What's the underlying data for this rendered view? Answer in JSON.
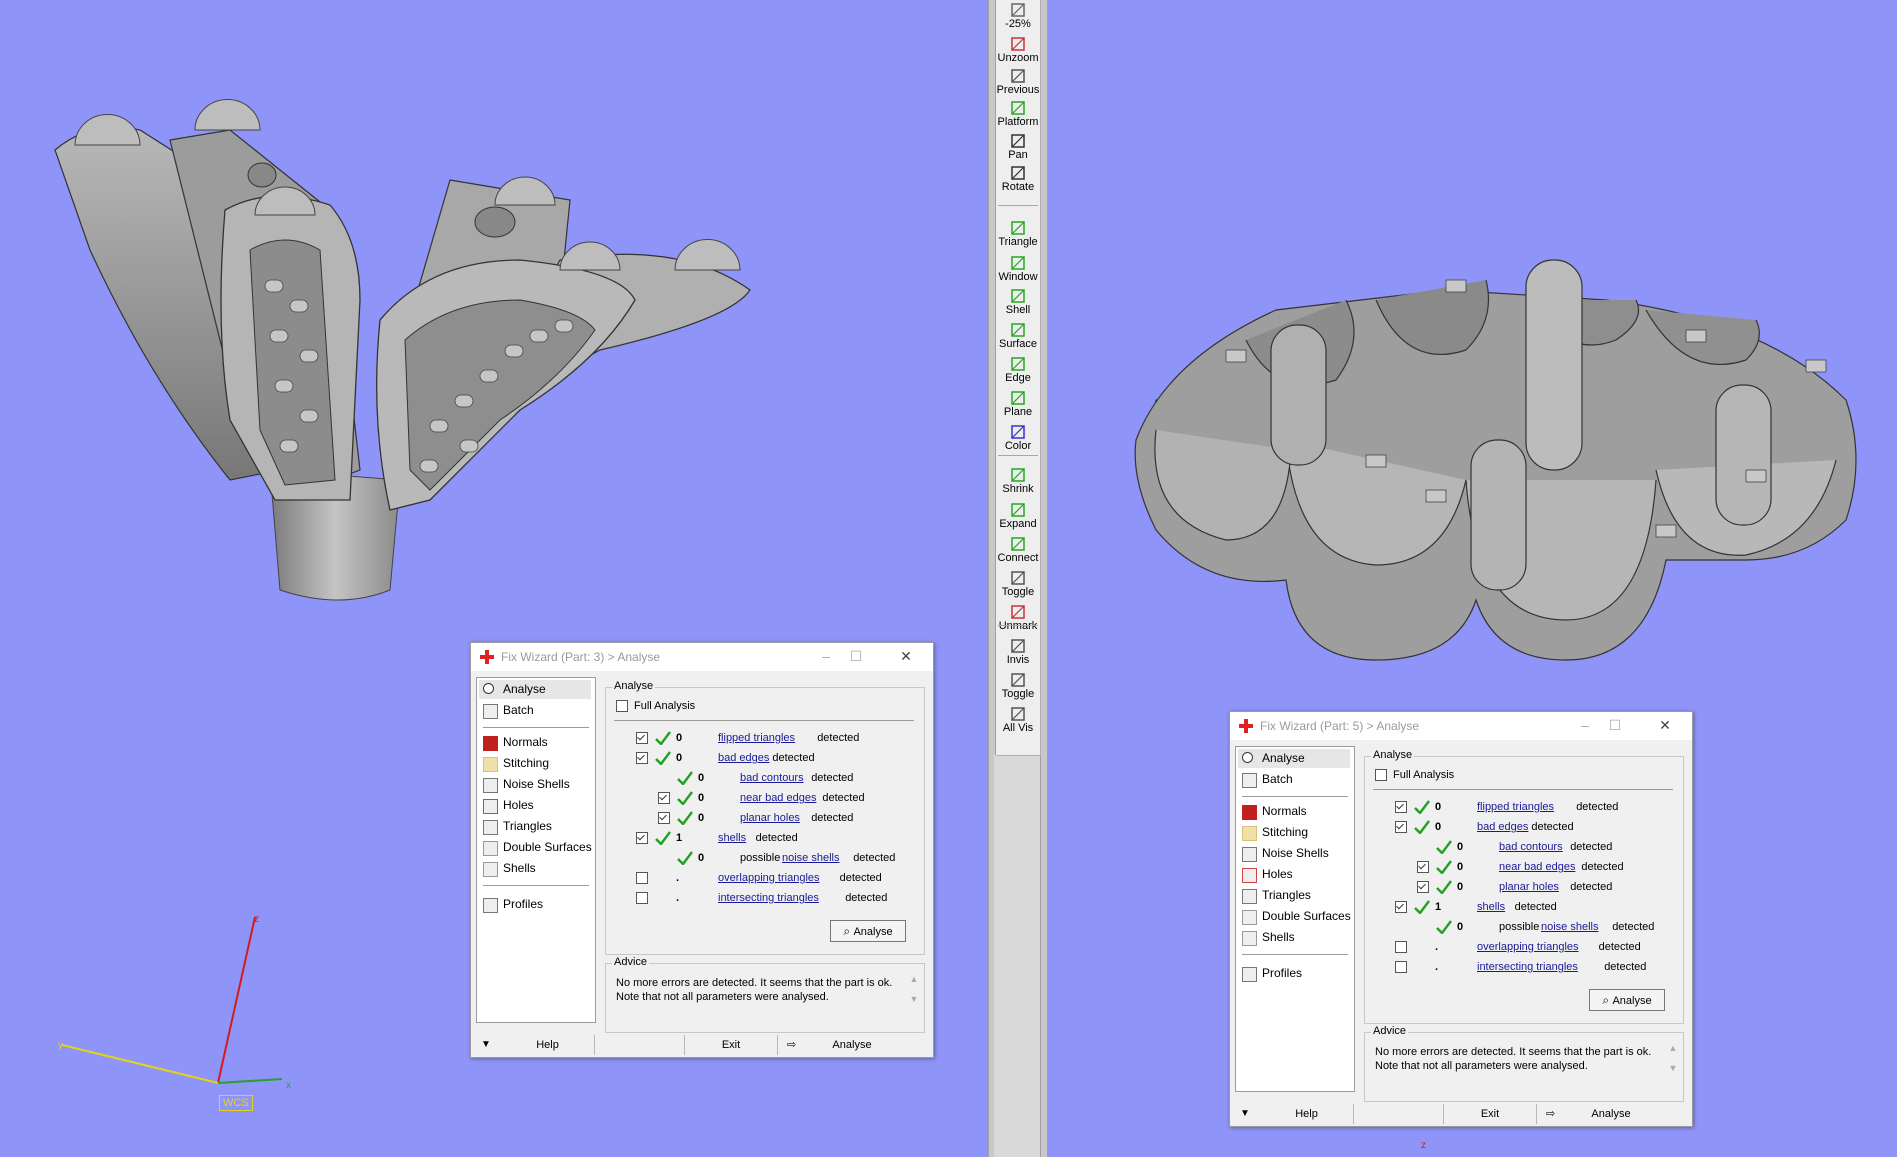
{
  "toolbar": {
    "items": [
      {
        "label": "-25%",
        "icon": "zoom-out-icon"
      },
      {
        "label": "Unzoom",
        "icon": "unzoom-icon"
      },
      {
        "label": "Previous",
        "icon": "previous-zoom-icon"
      },
      {
        "label": "Platform",
        "icon": "platform-icon"
      },
      {
        "label": "Pan",
        "icon": "pan-icon"
      },
      {
        "label": "Rotate",
        "icon": "rotate-icon"
      },
      {
        "label": "Triangle",
        "icon": "triangle-select-icon"
      },
      {
        "label": "Window",
        "icon": "window-select-icon"
      },
      {
        "label": "Shell",
        "icon": "shell-select-icon"
      },
      {
        "label": "Surface",
        "icon": "surface-select-icon"
      },
      {
        "label": "Edge",
        "icon": "edge-select-icon"
      },
      {
        "label": "Plane",
        "icon": "plane-select-icon"
      },
      {
        "label": "Color",
        "icon": "color-select-icon"
      },
      {
        "label": "Shrink",
        "icon": "shrink-icon"
      },
      {
        "label": "Expand",
        "icon": "expand-icon"
      },
      {
        "label": "Connect",
        "icon": "connect-icon"
      },
      {
        "label": "Toggle",
        "icon": "toggle-icon"
      },
      {
        "label": "Unmark",
        "icon": "unmark-icon"
      },
      {
        "label": "Invis",
        "icon": "invisible-icon"
      },
      {
        "label": "Toggle",
        "icon": "toggle-visible-icon"
      },
      {
        "label": "All Vis",
        "icon": "all-visible-icon"
      }
    ]
  },
  "dialogs": [
    {
      "title": "Fix Wizard (Part: 3) > Analyse",
      "sidebar": {
        "top": [
          {
            "label": "Analyse",
            "icon": "search-icon"
          },
          {
            "label": "Batch",
            "icon": "batch-icon"
          }
        ],
        "tools": [
          {
            "label": "Normals",
            "icon": "normals-icon"
          },
          {
            "label": "Stitching",
            "icon": "stitching-icon"
          },
          {
            "label": "Noise Shells",
            "icon": "noise-shells-icon"
          },
          {
            "label": "Holes",
            "icon": "holes-icon"
          },
          {
            "label": "Triangles",
            "icon": "triangles-icon"
          },
          {
            "label": "Double Surfaces",
            "icon": "double-surfaces-icon"
          },
          {
            "label": "Shells",
            "icon": "shells-icon"
          }
        ],
        "bottom": [
          {
            "label": "Profiles",
            "icon": "profiles-icon"
          }
        ]
      },
      "analyse_group": "Analyse",
      "full_analysis": "Full Analysis",
      "rows": [
        {
          "check": true,
          "ok": true,
          "value": "0",
          "link": "flipped triangles",
          "suffix": "detected",
          "indent": 0
        },
        {
          "check": true,
          "ok": true,
          "value": "0",
          "link": "bad edges",
          "suffix": "detected",
          "indent": 0
        },
        {
          "check": null,
          "ok": true,
          "value": "0",
          "link": "bad contours",
          "suffix": "detected",
          "indent": 1
        },
        {
          "check": true,
          "ok": true,
          "value": "0",
          "link": "near bad edges",
          "suffix": "detected",
          "indent": 1
        },
        {
          "check": true,
          "ok": true,
          "value": "0",
          "link": "planar holes",
          "suffix": "detected",
          "indent": 1
        },
        {
          "check": true,
          "ok": true,
          "value": "1",
          "link": "shells",
          "suffix": "detected",
          "indent": 0
        },
        {
          "check": null,
          "ok": true,
          "value": "0",
          "prefix": "possible",
          "link": "noise shells",
          "suffix": "detected",
          "indent": 1
        },
        {
          "check": false,
          "ok": false,
          "value": ".",
          "link": "overlapping triangles",
          "suffix": "detected",
          "indent": 0
        },
        {
          "check": false,
          "ok": false,
          "value": ".",
          "link": "intersecting triangles",
          "suffix": "detected",
          "indent": 0
        }
      ],
      "analyse_button": "Analyse",
      "advice_group": "Advice",
      "advice_text": "No more errors are detected. It seems that the part is ok. Note that not all parameters were analysed.",
      "footer": {
        "help": "Help",
        "exit": "Exit",
        "analyse": "Analyse"
      }
    },
    {
      "title": "Fix Wizard (Part: 5) > Analyse",
      "sidebar": {
        "top": [
          {
            "label": "Analyse",
            "icon": "search-icon"
          },
          {
            "label": "Batch",
            "icon": "batch-icon"
          }
        ],
        "tools": [
          {
            "label": "Normals",
            "icon": "normals-icon"
          },
          {
            "label": "Stitching",
            "icon": "stitching-icon"
          },
          {
            "label": "Noise Shells",
            "icon": "noise-shells-icon"
          },
          {
            "label": "Holes",
            "icon": "holes-icon"
          },
          {
            "label": "Triangles",
            "icon": "triangles-icon"
          },
          {
            "label": "Double Surfaces",
            "icon": "double-surfaces-icon"
          },
          {
            "label": "Shells",
            "icon": "shells-icon"
          }
        ],
        "bottom": [
          {
            "label": "Profiles",
            "icon": "profiles-icon"
          }
        ]
      },
      "analyse_group": "Analyse",
      "full_analysis": "Full Analysis",
      "rows": [
        {
          "check": true,
          "ok": true,
          "value": "0",
          "link": "flipped triangles",
          "suffix": "detected",
          "indent": 0
        },
        {
          "check": true,
          "ok": true,
          "value": "0",
          "link": "bad edges",
          "suffix": "detected",
          "indent": 0
        },
        {
          "check": null,
          "ok": true,
          "value": "0",
          "link": "bad contours",
          "suffix": "detected",
          "indent": 1
        },
        {
          "check": true,
          "ok": true,
          "value": "0",
          "link": "near bad edges",
          "suffix": "detected",
          "indent": 1
        },
        {
          "check": true,
          "ok": true,
          "value": "0",
          "link": "planar holes",
          "suffix": "detected",
          "indent": 1
        },
        {
          "check": true,
          "ok": true,
          "value": "1",
          "link": "shells",
          "suffix": "detected",
          "indent": 0
        },
        {
          "check": null,
          "ok": true,
          "value": "0",
          "prefix": "possible",
          "link": "noise shells",
          "suffix": "detected",
          "indent": 1
        },
        {
          "check": false,
          "ok": false,
          "value": ".",
          "link": "overlapping triangles",
          "suffix": "detected",
          "indent": 0
        },
        {
          "check": false,
          "ok": false,
          "value": ".",
          "link": "intersecting triangles",
          "suffix": "detected",
          "indent": 0
        }
      ],
      "analyse_button": "Analyse",
      "advice_group": "Advice",
      "advice_text": "No more errors are detected. It seems that the part is ok. Note that not all parameters were analysed.",
      "footer": {
        "help": "Help",
        "exit": "Exit",
        "analyse": "Analyse"
      }
    }
  ],
  "axes": {
    "z": "z",
    "y": "y",
    "x": "x",
    "wcs": "WCS"
  },
  "colors": {
    "background": "#8f95f8",
    "part": "#a4a4a4",
    "ok_check": "#22a022",
    "link": "#1a1a99",
    "axis_z": "#d21c1c",
    "axis_y": "#e6d21a",
    "axis_x": "#2aa02a"
  }
}
